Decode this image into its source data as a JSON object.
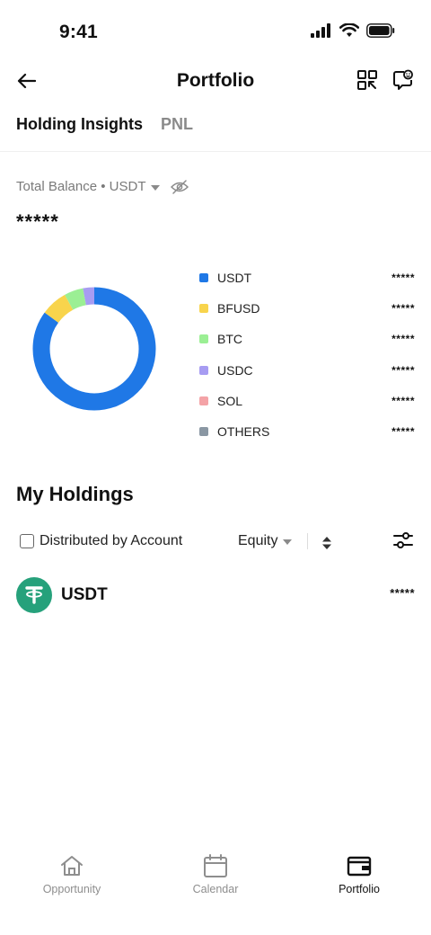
{
  "status_bar": {
    "time": "9:41"
  },
  "header": {
    "title": "Portfolio"
  },
  "tabs": [
    {
      "label": "Holding Insights",
      "active": true
    },
    {
      "label": "PNL",
      "active": false
    }
  ],
  "balance": {
    "label": "Total Balance • USDT",
    "value": "*****"
  },
  "chart_data": {
    "type": "pie",
    "categories": [
      "USDT",
      "BFUSD",
      "BTC",
      "USDC",
      "SOL",
      "OTHERS"
    ],
    "values": [
      85,
      7,
      5,
      3,
      0,
      0
    ],
    "value_labels": [
      "*****",
      "*****",
      "*****",
      "*****",
      "*****",
      "*****"
    ],
    "colors": [
      "#1f78e6",
      "#f8d44c",
      "#9bef94",
      "#a79cf2",
      "#f4a3a7",
      "#8a97a3"
    ],
    "donut": true,
    "legend_position": "right"
  },
  "holdings": {
    "title": "My Holdings",
    "filter_label": "Distributed by Account",
    "sort_label": "Equity",
    "items": [
      {
        "name": "USDT",
        "value": "*****",
        "icon": "tether-icon",
        "color": "#26a17b"
      }
    ]
  },
  "bottom_nav": [
    {
      "label": "Opportunity",
      "icon": "home-icon",
      "active": false
    },
    {
      "label": "Calendar",
      "icon": "calendar-icon",
      "active": false
    },
    {
      "label": "Portfolio",
      "icon": "wallet-icon",
      "active": true
    }
  ]
}
